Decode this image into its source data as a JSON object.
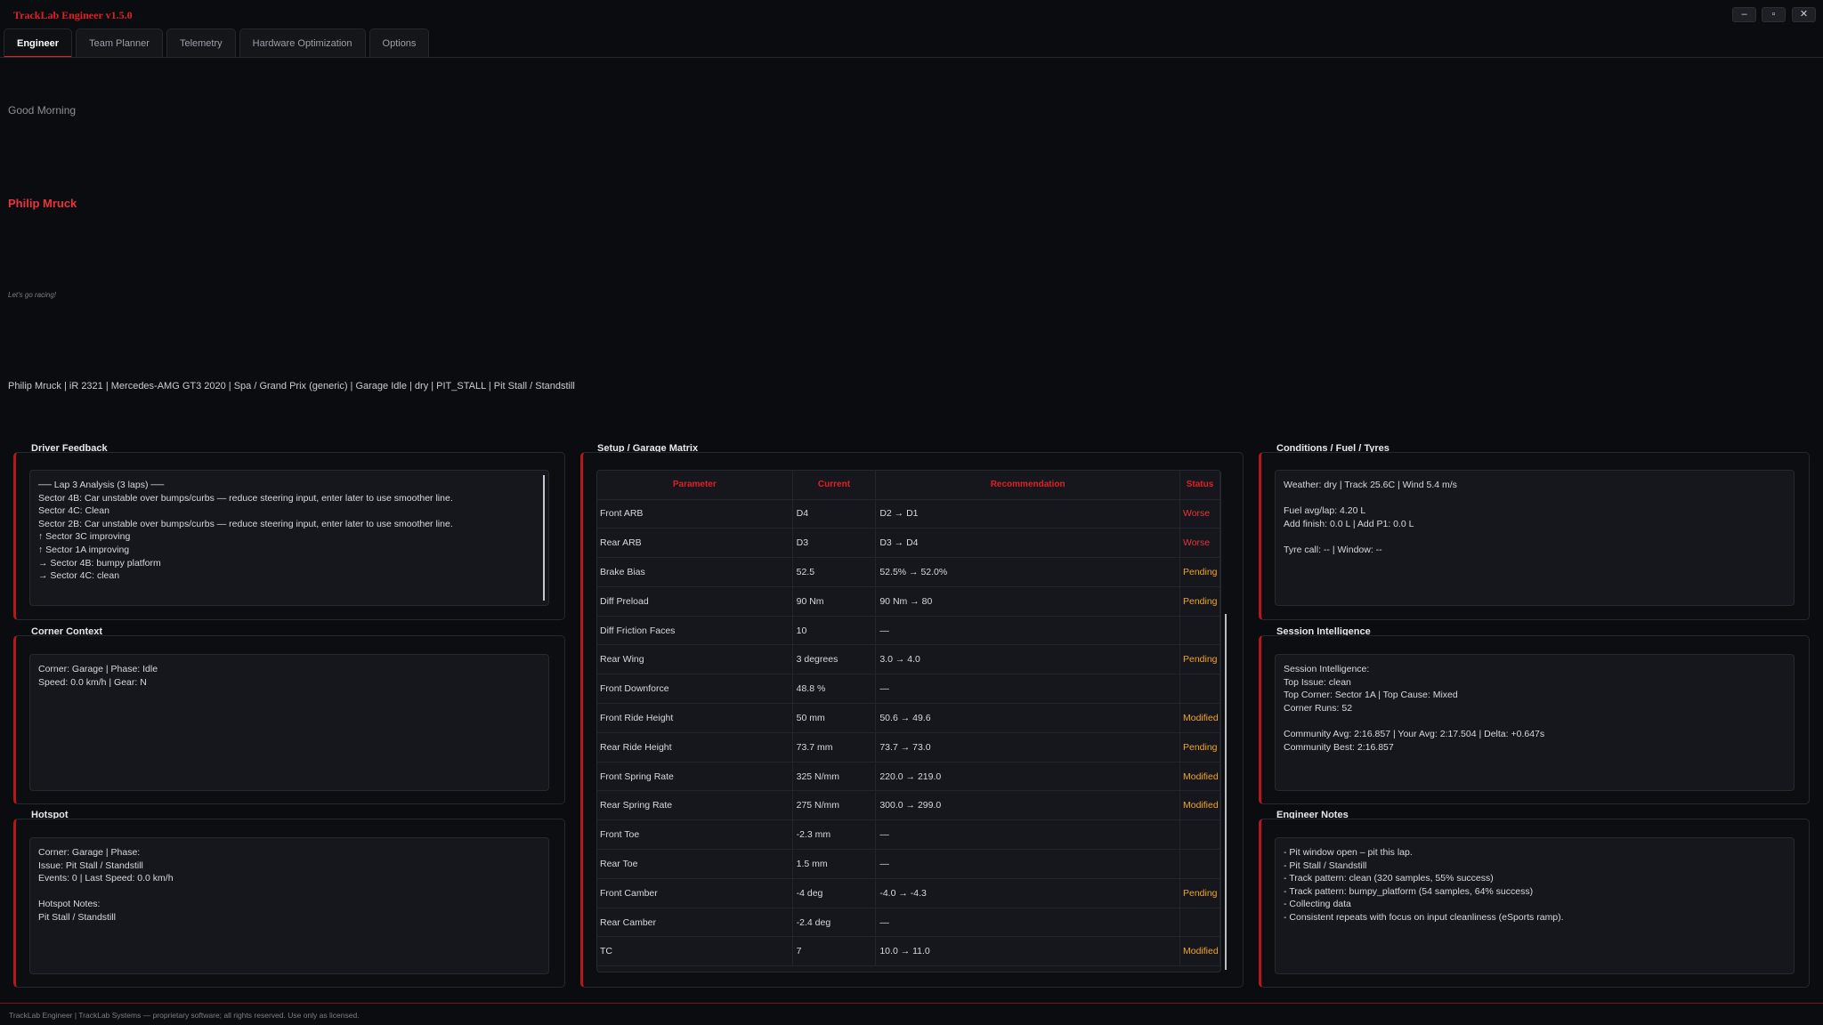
{
  "app": {
    "title": "TrackLab Engineer v1.5.0"
  },
  "window_controls": {
    "minimize": "–",
    "maximize": "▫",
    "close": "✕"
  },
  "tabs": [
    "Engineer",
    "Team Planner",
    "Telemetry",
    "Hardware Optimization",
    "Options"
  ],
  "header": {
    "greeting": "Good Morning",
    "driver_name": "Philip Mruck",
    "tagline": "Let's go racing!",
    "status_line": "Philip Mruck | iR 2321 | Mercedes-AMG GT3 2020 | Spa / Grand Prix (generic) | Garage Idle | dry | PIT_STALL | Pit Stall / Standstill"
  },
  "driver_feedback": {
    "title": "Driver Feedback",
    "text": "── Lap 3 Analysis (3 laps) ──\n   Sector 4B: Car unstable over bumps/curbs — reduce steering input, enter later to use smoother line.\n   Sector 4C: Clean\n   Sector 2B: Car unstable over bumps/curbs — reduce steering input, enter later to use smoother line.\n   ↑ Sector 3C improving\n   ↑ Sector 1A improving\n   → Sector 4B: bumpy platform\n   → Sector 4C: clean"
  },
  "corner_context": {
    "title": "Corner Context",
    "text": "Corner: Garage | Phase: Idle\nSpeed: 0.0 km/h | Gear: N"
  },
  "hotspot": {
    "title": "Hotspot",
    "text": "Corner: Garage | Phase:\nIssue: Pit Stall / Standstill\nEvents: 0 | Last Speed: 0.0 km/h\n\nHotspot Notes:\nPit Stall / Standstill"
  },
  "setup_matrix": {
    "title": "Setup / Garage Matrix",
    "columns": [
      "Parameter",
      "Current",
      "Recommendation",
      "Status"
    ],
    "rows": [
      {
        "parameter": "Front ARB",
        "current": "D4",
        "recommendation": "D2 → D1",
        "status": "Worse"
      },
      {
        "parameter": "Rear ARB",
        "current": "D3",
        "recommendation": "D3 → D4",
        "status": "Worse"
      },
      {
        "parameter": "Brake Bias",
        "current": "52.5",
        "recommendation": "52.5% → 52.0%",
        "status": "Pending"
      },
      {
        "parameter": "Diff Preload",
        "current": "90 Nm",
        "recommendation": "90 Nm → 80",
        "status": "Pending"
      },
      {
        "parameter": "Diff Friction Faces",
        "current": "10",
        "recommendation": "—",
        "status": ""
      },
      {
        "parameter": "Rear Wing",
        "current": "3 degrees",
        "recommendation": "3.0 → 4.0",
        "status": "Pending"
      },
      {
        "parameter": "Front Downforce",
        "current": "48.8 %",
        "recommendation": "—",
        "status": ""
      },
      {
        "parameter": "Front Ride Height",
        "current": "50 mm",
        "recommendation": "50.6 → 49.6",
        "status": "Modified"
      },
      {
        "parameter": "Rear Ride Height",
        "current": "73.7 mm",
        "recommendation": "73.7 → 73.0",
        "status": "Pending"
      },
      {
        "parameter": "Front Spring Rate",
        "current": "325 N/mm",
        "recommendation": "220.0 → 219.0",
        "status": "Modified"
      },
      {
        "parameter": "Rear Spring Rate",
        "current": "275 N/mm",
        "recommendation": "300.0 → 299.0",
        "status": "Modified"
      },
      {
        "parameter": "Front Toe",
        "current": "-2.3 mm",
        "recommendation": "—",
        "status": ""
      },
      {
        "parameter": "Rear Toe",
        "current": "1.5 mm",
        "recommendation": "—",
        "status": ""
      },
      {
        "parameter": "Front Camber",
        "current": "-4 deg",
        "recommendation": "-4.0 → -4.3",
        "status": "Pending"
      },
      {
        "parameter": "Rear Camber",
        "current": "-2.4 deg",
        "recommendation": "—",
        "status": ""
      },
      {
        "parameter": "TC",
        "current": "7",
        "recommendation": "10.0 → 11.0",
        "status": "Modified"
      }
    ]
  },
  "conditions": {
    "title": "Conditions / Fuel / Tyres",
    "text": "Weather: dry | Track 25.6C | Wind 5.4 m/s\n\nFuel avg/lap: 4.20 L\nAdd finish: 0.0 L | Add P1: 0.0 L\n\nTyre call: -- | Window: --"
  },
  "session_intelligence": {
    "title": "Session Intelligence",
    "text": "Session Intelligence:\nTop Issue: clean\nTop Corner: Sector 1A | Top Cause: Mixed\nCorner Runs: 52\n\nCommunity Avg: 2:16.857 | Your Avg: 2:17.504 | Delta: +0.647s\nCommunity Best: 2:16.857"
  },
  "engineer_notes": {
    "title": "Engineer Notes",
    "text": "- Pit window open – pit this lap.\n- Pit Stall / Standstill\n- Track pattern: clean (320 samples, 55% success)\n- Track pattern: bumpy_platform (54 samples, 64% success)\n- Collecting data\n- Consistent repeats with focus on input cleanliness (eSports ramp)."
  },
  "footer": {
    "text": "TrackLab Engineer | TrackLab Systems — proprietary software; all rights reserved. Use only as licensed."
  },
  "colors": {
    "accent": "#e21f26",
    "pending": "#f2a42a",
    "background": "#0b0c0f"
  }
}
